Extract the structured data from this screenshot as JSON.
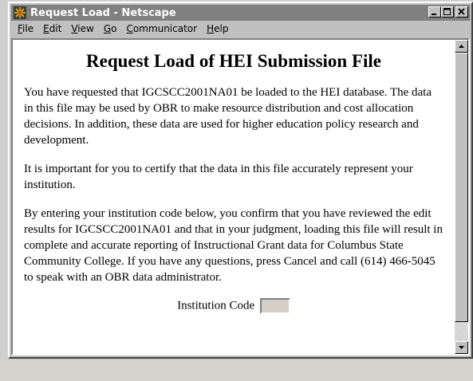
{
  "window": {
    "title": "Request Load - Netscape",
    "controls": {
      "minimize": "_",
      "maximize": "□",
      "close": "×"
    }
  },
  "menubar": {
    "items": [
      {
        "label": "File",
        "underline": "F",
        "rest": "ile"
      },
      {
        "label": "Edit",
        "underline": "E",
        "rest": "dit"
      },
      {
        "label": "View",
        "underline": "V",
        "rest": "iew"
      },
      {
        "label": "Go",
        "underline": "G",
        "rest": "o"
      },
      {
        "label": "Communicator",
        "underline": "C",
        "rest": "ommunicator"
      },
      {
        "label": "Help",
        "underline": "H",
        "rest": "elp"
      }
    ]
  },
  "page": {
    "heading": "Request Load of HEI Submission File",
    "paragraphs": [
      "You have requested that IGCSCC2001NA01 be loaded to the HEI database. The data in this file may be used by OBR to make resource distribution and cost allocation decisions. In addition, these data are used for higher education policy research and development.",
      "It is important for you to certify that the data in this file accurately represent your institution.",
      "By entering your institution code below, you confirm that you have reviewed the edit results for IGCSCC2001NA01 and that in your judgment, loading this file will result in complete and accurate reporting of Instructional Grant data for Columbus State Community College. If you have any questions, press Cancel and call (614) 466-5045 to speak with an OBR data administrator."
    ],
    "institution_code": {
      "label": "Institution Code",
      "value": ""
    }
  },
  "scroll": {
    "position": 0
  }
}
